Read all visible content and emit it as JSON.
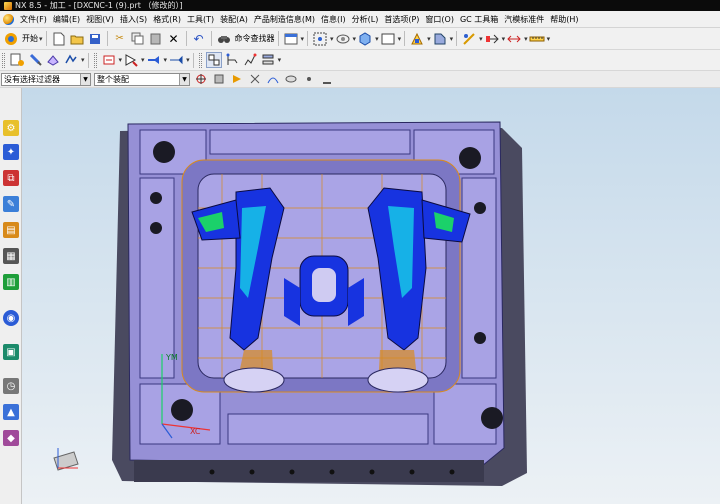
{
  "window": {
    "title": "NX 8.5 - 加工 - [DXCNC-1 (9).prt （修改的）]"
  },
  "menu": [
    "文件(F)",
    "编辑(E)",
    "视图(V)",
    "插入(S)",
    "格式(R)",
    "工具(T)",
    "装配(A)",
    "产品制造信息(M)",
    "信息(I)",
    "分析(L)",
    "首选项(P)",
    "窗口(O)",
    "GC 工具箱",
    "汽模标准件",
    "帮助(H)"
  ],
  "toolbar1": {
    "start_label": "开始",
    "command_finder_label": "命令查找器"
  },
  "selection_bar": {
    "filter_value": "没有选择过滤器",
    "assembly_scope_value": "整个装配"
  },
  "triad": {
    "y_label": "YM",
    "x_label": "XC"
  },
  "icons": {
    "start": "nx-start-icon",
    "new": "new-file-icon",
    "open": "open-folder-icon",
    "save": "save-icon",
    "cut": "cut-icon",
    "copy": "copy-icon",
    "paste": "paste-icon",
    "delete": "delete-icon",
    "undo": "undo-icon",
    "command_finder": "binoculars-icon"
  },
  "colors": {
    "viewport_top": "#c4d9ea",
    "mold_plate": "#9690d6",
    "toolpath_blue": "#1733e0",
    "wire_orange": "#d98a1e"
  }
}
